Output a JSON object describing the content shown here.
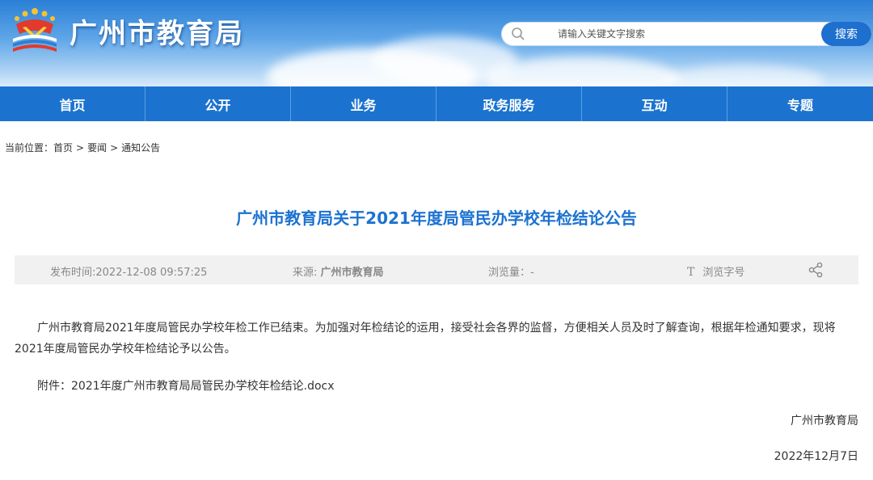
{
  "header": {
    "site_title": "广州市教育局",
    "logo_icon": "education-bureau-emblem-icon",
    "search": {
      "placeholder": "请输入关键文字搜索",
      "button_label": "搜索"
    }
  },
  "nav": {
    "items": [
      {
        "label": "首页"
      },
      {
        "label": "公开"
      },
      {
        "label": "业务"
      },
      {
        "label": "政务服务"
      },
      {
        "label": "互动"
      },
      {
        "label": "专题"
      }
    ]
  },
  "breadcrumb": {
    "prefix": "当前位置：",
    "items": [
      {
        "label": "首页"
      },
      {
        "label": "要闻"
      },
      {
        "label": "通知公告"
      }
    ],
    "separator": ">"
  },
  "article": {
    "title": "广州市教育局关于2021年度局管民办学校年检结论公告",
    "meta": {
      "publish_time": "发布时间:2022-12-08 09:57:25",
      "source_label": "来源:",
      "source_value": "广州市教育局",
      "views": "浏览量：-",
      "font_icon": "T",
      "font_label": "浏览字号",
      "share_icon": "share-icon"
    },
    "body": "广州市教育局2021年度局管民办学校年检工作已结束。为加强对年检结论的运用，接受社会各界的监督，方便相关人员及时了解查询，根据年检通知要求，现将2021年度局管民办学校年检结论予以公告。",
    "attachment_label": "附件：",
    "attachment_link": "2021年度广州市教育局局管民办学校年检结论.docx",
    "signature": "广州市教育局",
    "date": "2022年12月7日"
  },
  "colors": {
    "nav_bg": "#1b73cf",
    "title": "#1c72d0",
    "search_button": "#1e6fce"
  }
}
